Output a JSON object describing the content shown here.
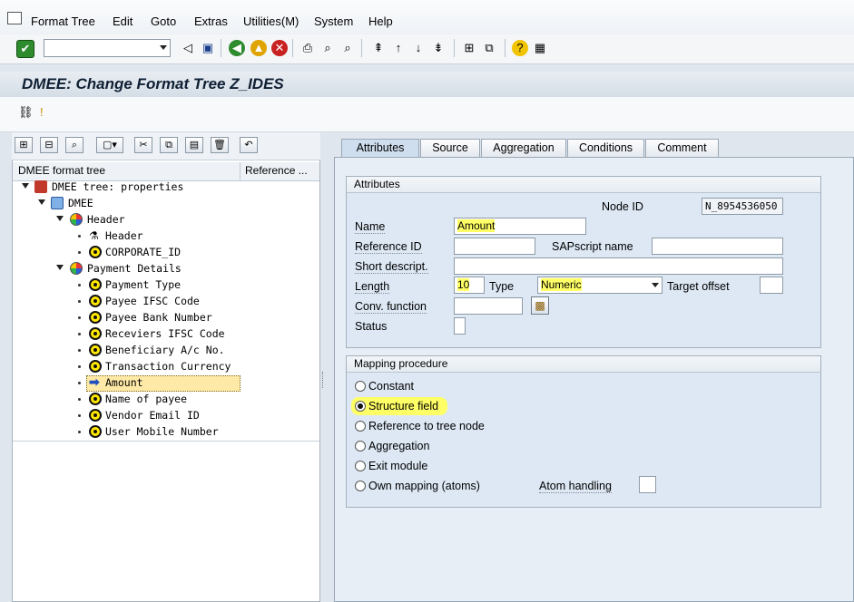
{
  "menu": [
    "Format Tree",
    "Edit",
    "Goto",
    "Extras",
    "Utilities(M)",
    "System",
    "Help"
  ],
  "page_title": "DMEE: Change Format Tree Z_IDES",
  "tree": {
    "columns": [
      "DMEE format tree",
      "Reference ..."
    ],
    "nodes": [
      "DMEE tree: properties",
      "DMEE",
      "Header",
      "Header",
      "CORPORATE_ID",
      "Payment Details",
      "Payment Type",
      "Payee IFSC Code",
      "Payee Bank Number",
      "Receviers IFSC Code",
      "Beneficiary A/c No.",
      "Transaction Currency",
      "Amount",
      "Name of payee",
      "Vendor Email ID",
      "User Mobile Number"
    ]
  },
  "tabs": [
    "Attributes",
    "Source",
    "Aggregation",
    "Conditions",
    "Comment"
  ],
  "attributes": {
    "group_title": "Attributes",
    "node_id_label": "Node ID",
    "node_id_value": "N_8954536050",
    "name_label": "Name",
    "name_value": "Amount",
    "reference_id_label": "Reference ID",
    "sapscript_label": "SAPscript name",
    "short_descr_label": "Short descript.",
    "length_label": "Length",
    "length_value": "10",
    "type_label": "Type",
    "type_value": "Numeric",
    "target_offset_label": "Target offset",
    "conv_function_label": "Conv. function",
    "status_label": "Status"
  },
  "mapping": {
    "group_title": "Mapping procedure",
    "options": [
      "Constant",
      "Structure field",
      "Reference to tree node",
      "Aggregation",
      "Exit module",
      "Own mapping (atoms)"
    ],
    "selected": "Structure field",
    "atom_handling_label": "Atom handling"
  },
  "colors": {
    "highlight": "#ffff66",
    "selected_row": "#ffe9a6",
    "tab_active": "#cfdeef"
  }
}
